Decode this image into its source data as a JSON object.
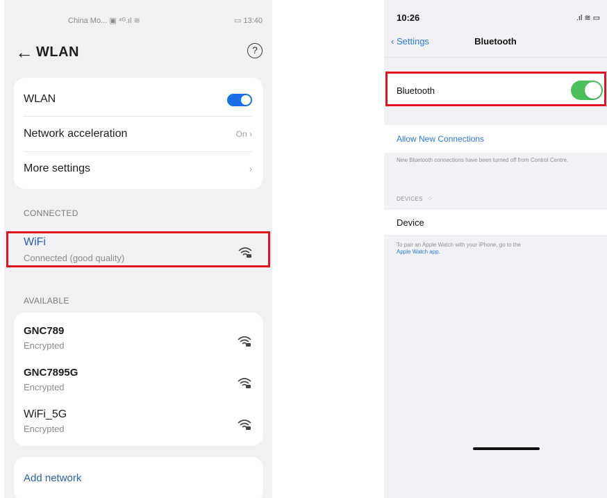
{
  "android": {
    "status": {
      "carrier": "China Mo...",
      "icons": "▣ ⁴ᴳ.ıl ≋",
      "battery": "▭",
      "time": "13:40"
    },
    "header": {
      "title": "WLAN"
    },
    "settings": [
      {
        "label": "WLAN",
        "control": "toggle",
        "state": "on"
      },
      {
        "label": "Network acceleration",
        "value": "On"
      },
      {
        "label": "More settings"
      }
    ],
    "connected_header": "CONNECTED",
    "connected": {
      "name": "WiFi",
      "status": "Connected (good quality)"
    },
    "available_header": "AVAILABLE",
    "available": [
      {
        "name": "GNC789",
        "security": "Encrypted"
      },
      {
        "name": "GNC7895G",
        "security": "Encrypted"
      },
      {
        "name": "WiFi_5G",
        "security": "Encrypted"
      }
    ],
    "add_network": "Add network",
    "colors": {
      "accent": "#1a6fe8",
      "highlight": "#e0141e",
      "background": "#f1f1f3"
    },
    "icons": {
      "back": "back-arrow-icon",
      "help": "help-circle-icon",
      "wifi": "wifi-locked-icon",
      "chevron": "chevron-right-icon"
    }
  },
  "ios": {
    "status": {
      "time": "10:26",
      "icons": ".ıl ≋ ▭"
    },
    "nav": {
      "back_label": "Settings",
      "title": "Bluetooth"
    },
    "bluetooth_row": {
      "label": "Bluetooth",
      "state": "on"
    },
    "allow_new_connections": "Allow New Connections",
    "note": "New Bluetooth connections have been turned off from Control Centre.",
    "devices_header": "DEVICES",
    "device": "Device",
    "pair_note_prefix": "To pair an Apple Watch with your iPhone, go to the",
    "pair_note_link": "Apple Watch app.",
    "colors": {
      "tint": "#2a7ae2",
      "toggle_on": "#4cc15a"
    }
  }
}
